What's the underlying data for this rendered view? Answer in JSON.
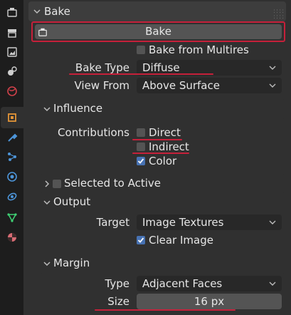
{
  "toolstrip": {
    "items": [
      {
        "icon": "tool-icon"
      },
      {
        "icon": "render-icon"
      },
      {
        "icon": "output-icon"
      },
      {
        "icon": "view-layer-icon"
      },
      {
        "icon": "world-icon"
      },
      {
        "icon": "object-icon"
      },
      {
        "icon": "modifiers-icon"
      },
      {
        "icon": "particles-icon"
      },
      {
        "icon": "physics-icon"
      },
      {
        "icon": "constraints-icon"
      },
      {
        "icon": "data-icon"
      },
      {
        "icon": "material-icon"
      }
    ]
  },
  "bake": {
    "title": "Bake",
    "button_label": "Bake",
    "from_multires_label": "Bake from Multires",
    "from_multires_checked": false,
    "bake_type_label": "Bake Type",
    "bake_type_value": "Diffuse",
    "view_from_label": "View From",
    "view_from_value": "Above Surface"
  },
  "influence": {
    "title": "Influence",
    "contributions_label": "Contributions",
    "direct_label": "Direct",
    "direct_checked": false,
    "indirect_label": "Indirect",
    "indirect_checked": false,
    "color_label": "Color",
    "color_checked": true
  },
  "selected_to_active": {
    "title": "Selected to Active",
    "checked": false
  },
  "output": {
    "title": "Output",
    "target_label": "Target",
    "target_value": "Image Textures",
    "clear_image_label": "Clear Image",
    "clear_image_checked": true
  },
  "margin": {
    "title": "Margin",
    "type_label": "Type",
    "type_value": "Adjacent Faces",
    "size_label": "Size",
    "size_value": "16 px"
  },
  "colors": {
    "annotation_red": "#c6203a",
    "checkbox_on": "#4772b3"
  }
}
